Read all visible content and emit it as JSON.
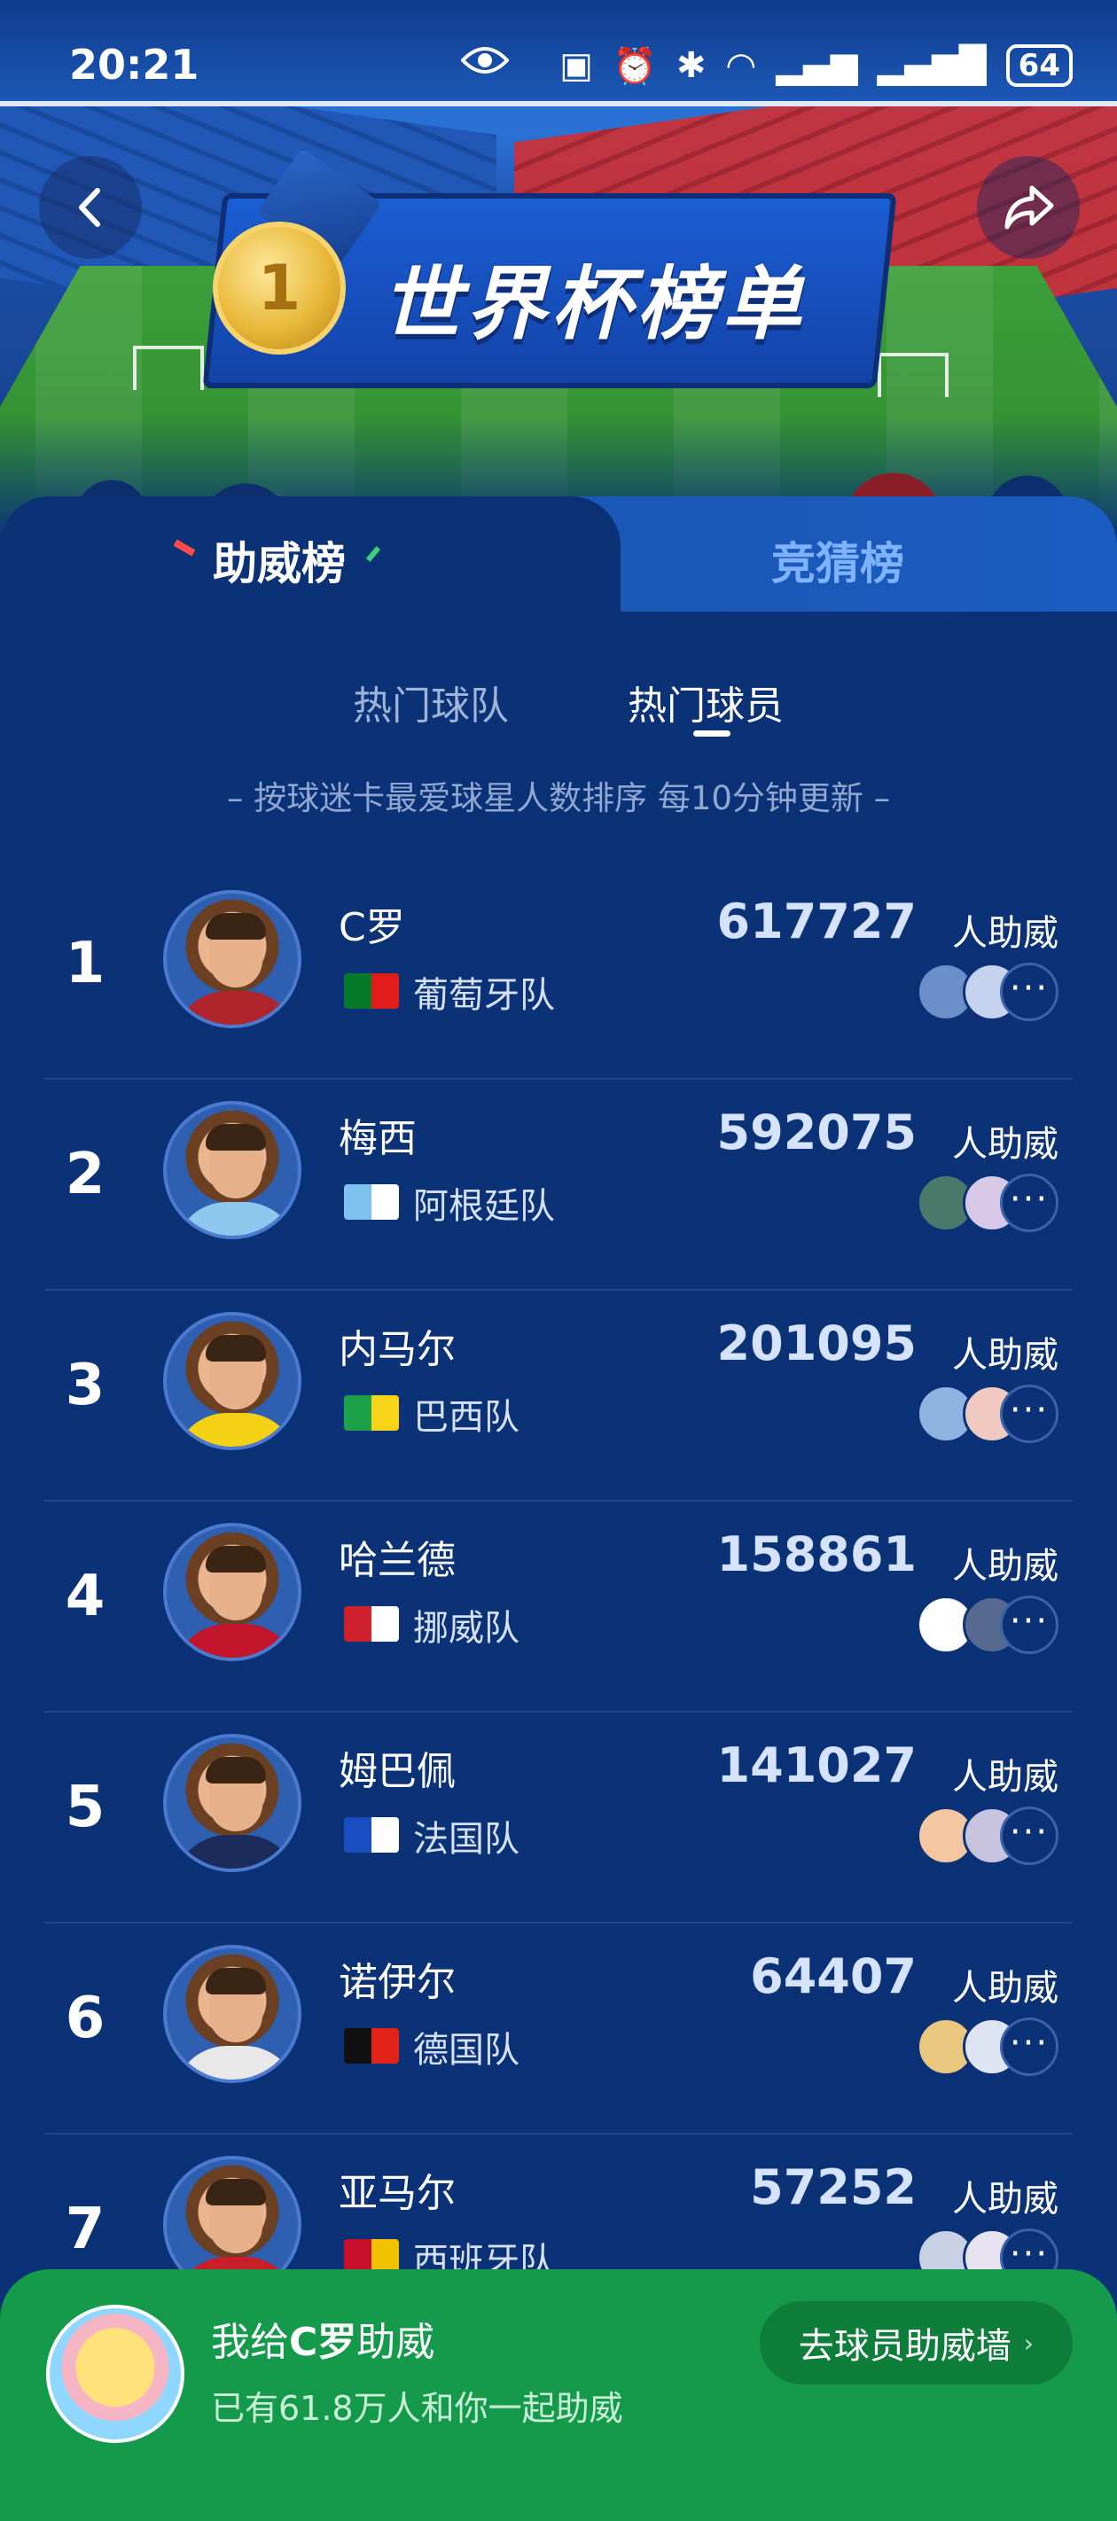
{
  "status": {
    "time": "20:21",
    "battery": "64"
  },
  "banner": {
    "title": "世界杯榜单",
    "medal_number": "1"
  },
  "tabs": {
    "active": "助威榜",
    "inactive": "竞猜榜"
  },
  "subtabs": {
    "teams": "热门球队",
    "players": "热门球员"
  },
  "subtitle": "– 按球迷卡最爱球星人数排序  每10分钟更新 –",
  "count_unit": "人助威",
  "more_label": "···",
  "players": [
    {
      "rank": "1",
      "name": "C罗",
      "team": "葡萄牙队",
      "count": "617727",
      "shirt": "#b0242c",
      "flag": [
        "#067a2a",
        "#e21b1b"
      ]
    },
    {
      "rank": "2",
      "name": "梅西",
      "team": "阿根廷队",
      "count": "592075",
      "shirt": "#8ec6ee",
      "flag": [
        "#7ec3ef",
        "#ffffff"
      ]
    },
    {
      "rank": "3",
      "name": "内马尔",
      "team": "巴西队",
      "count": "201095",
      "shirt": "#f5d115",
      "flag": [
        "#1ca048",
        "#f7d417"
      ]
    },
    {
      "rank": "4",
      "name": "哈兰德",
      "team": "挪威队",
      "count": "158861",
      "shirt": "#c3162c",
      "flag": [
        "#d0202e",
        "#ffffff"
      ]
    },
    {
      "rank": "5",
      "name": "姆巴佩",
      "team": "法国队",
      "count": "141027",
      "shirt": "#1b2c5c",
      "flag": [
        "#1a4cc2",
        "#ffffff"
      ]
    },
    {
      "rank": "6",
      "name": "诺伊尔",
      "team": "德国队",
      "count": "64407",
      "shirt": "#e8e8e8",
      "flag": [
        "#111111",
        "#e2231a"
      ]
    },
    {
      "rank": "7",
      "name": "亚马尔",
      "team": "西班牙队",
      "count": "57252",
      "shirt": "#c81e2a",
      "flag": [
        "#c8102e",
        "#f2c200"
      ]
    }
  ],
  "bottom": {
    "title_prefix": "我给",
    "title_name": "C罗",
    "title_suffix": "助威",
    "subtitle": "已有61.8万人和你一起助威",
    "button": "去球员助威墙"
  }
}
